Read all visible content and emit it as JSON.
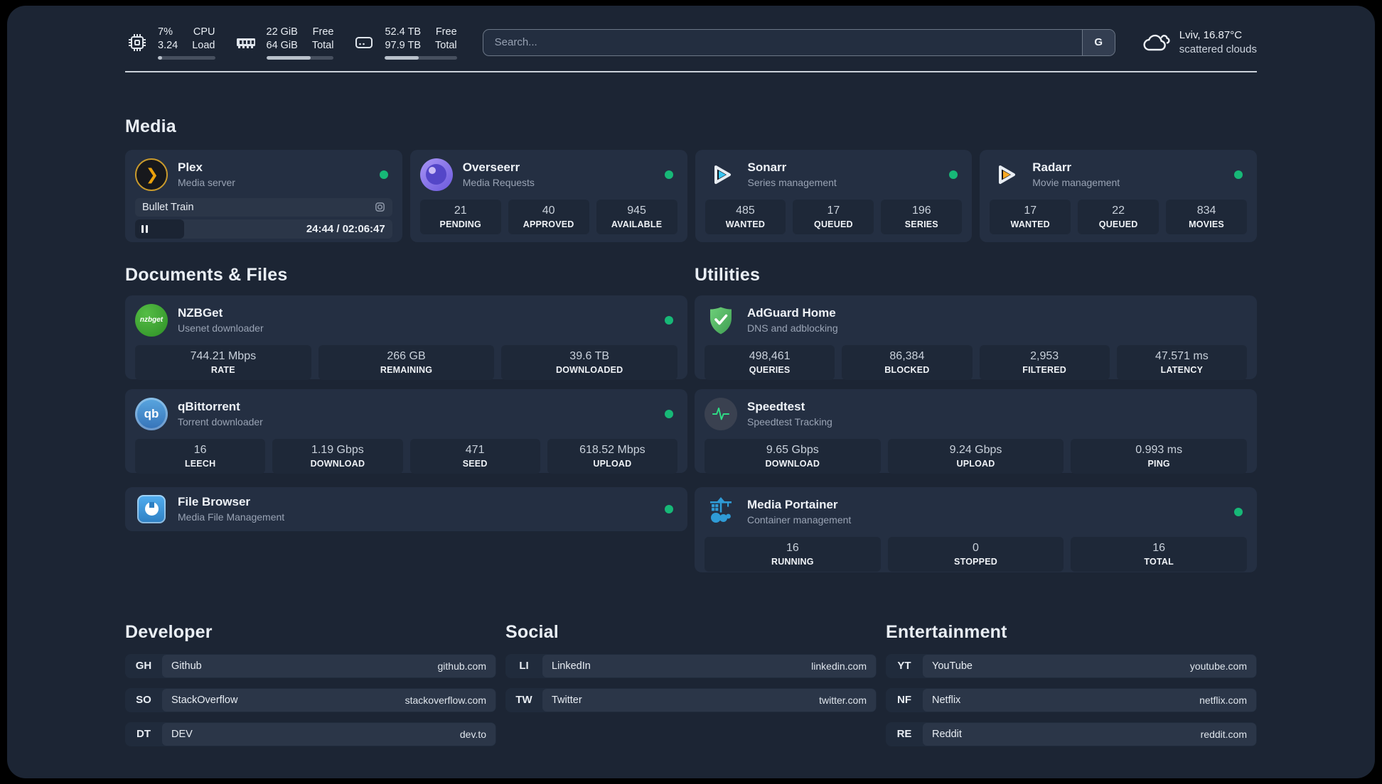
{
  "header": {
    "stats": [
      {
        "value_top": "7%",
        "value_bottom": "3.24",
        "label_top": "CPU",
        "label_bottom": "Load",
        "progress_pct": 8
      },
      {
        "value_top": "22 GiB",
        "value_bottom": "64 GiB",
        "label_top": "Free",
        "label_bottom": "Total",
        "progress_pct": 66
      },
      {
        "value_top": "52.4 TB",
        "value_bottom": "97.9 TB",
        "label_top": "Free",
        "label_bottom": "Total",
        "progress_pct": 47
      }
    ],
    "search": {
      "placeholder": "Search...",
      "button_label": "G"
    },
    "weather": {
      "location_temp": "Lviv, 16.87°C",
      "condition": "scattered clouds"
    }
  },
  "sections": {
    "media": {
      "title": "Media",
      "apps": [
        {
          "name": "Plex",
          "description": "Media server",
          "online": true,
          "player": {
            "now_playing": "Bullet Train",
            "time_display": "24:44 / 02:06:47",
            "progress_pct": 19
          }
        },
        {
          "name": "Overseerr",
          "description": "Media Requests",
          "online": true,
          "stats": [
            {
              "value": "21",
              "label": "PENDING"
            },
            {
              "value": "40",
              "label": "APPROVED"
            },
            {
              "value": "945",
              "label": "AVAILABLE"
            }
          ]
        },
        {
          "name": "Sonarr",
          "description": "Series management",
          "online": true,
          "stats": [
            {
              "value": "485",
              "label": "WANTED"
            },
            {
              "value": "17",
              "label": "QUEUED"
            },
            {
              "value": "196",
              "label": "SERIES"
            }
          ]
        },
        {
          "name": "Radarr",
          "description": "Movie management",
          "online": true,
          "stats": [
            {
              "value": "17",
              "label": "WANTED"
            },
            {
              "value": "22",
              "label": "QUEUED"
            },
            {
              "value": "834",
              "label": "MOVIES"
            }
          ]
        }
      ]
    },
    "documents": {
      "title": "Documents & Files",
      "apps": [
        {
          "name": "NZBGet",
          "description": "Usenet downloader",
          "online": true,
          "icon_text": "nzbget",
          "stats": [
            {
              "value": "744.21 Mbps",
              "label": "RATE"
            },
            {
              "value": "266 GB",
              "label": "REMAINING"
            },
            {
              "value": "39.6 TB",
              "label": "DOWNLOADED"
            }
          ]
        },
        {
          "name": "qBittorrent",
          "description": "Torrent downloader",
          "online": true,
          "icon_text": "qb",
          "stats": [
            {
              "value": "16",
              "label": "LEECH"
            },
            {
              "value": "1.19 Gbps",
              "label": "DOWNLOAD"
            },
            {
              "value": "471",
              "label": "SEED"
            },
            {
              "value": "618.52 Mbps",
              "label": "UPLOAD"
            }
          ]
        },
        {
          "name": "File Browser",
          "description": "Media File Management",
          "online": true
        }
      ]
    },
    "utilities": {
      "title": "Utilities",
      "apps": [
        {
          "name": "AdGuard Home",
          "description": "DNS and adblocking",
          "stats": [
            {
              "value": "498,461",
              "label": "QUERIES"
            },
            {
              "value": "86,384",
              "label": "BLOCKED"
            },
            {
              "value": "2,953",
              "label": "FILTERED"
            },
            {
              "value": "47.571 ms",
              "label": "LATENCY"
            }
          ]
        },
        {
          "name": "Speedtest",
          "description": "Speedtest Tracking",
          "stats": [
            {
              "value": "9.65 Gbps",
              "label": "DOWNLOAD"
            },
            {
              "value": "9.24 Gbps",
              "label": "UPLOAD"
            },
            {
              "value": "0.993 ms",
              "label": "PING"
            }
          ]
        },
        {
          "name": "Media Portainer",
          "description": "Container management",
          "online": true,
          "stats": [
            {
              "value": "16",
              "label": "RUNNING"
            },
            {
              "value": "0",
              "label": "STOPPED"
            },
            {
              "value": "16",
              "label": "TOTAL"
            }
          ]
        }
      ]
    },
    "developer": {
      "title": "Developer",
      "links": [
        {
          "abbr": "GH",
          "name": "Github",
          "url": "github.com"
        },
        {
          "abbr": "SO",
          "name": "StackOverflow",
          "url": "stackoverflow.com"
        },
        {
          "abbr": "DT",
          "name": "DEV",
          "url": "dev.to"
        }
      ]
    },
    "social": {
      "title": "Social",
      "links": [
        {
          "abbr": "LI",
          "name": "LinkedIn",
          "url": "linkedin.com"
        },
        {
          "abbr": "TW",
          "name": "Twitter",
          "url": "twitter.com"
        }
      ]
    },
    "entertainment": {
      "title": "Entertainment",
      "links": [
        {
          "abbr": "YT",
          "name": "YouTube",
          "url": "youtube.com"
        },
        {
          "abbr": "NF",
          "name": "Netflix",
          "url": "netflix.com"
        },
        {
          "abbr": "RE",
          "name": "Reddit",
          "url": "reddit.com"
        }
      ]
    }
  }
}
